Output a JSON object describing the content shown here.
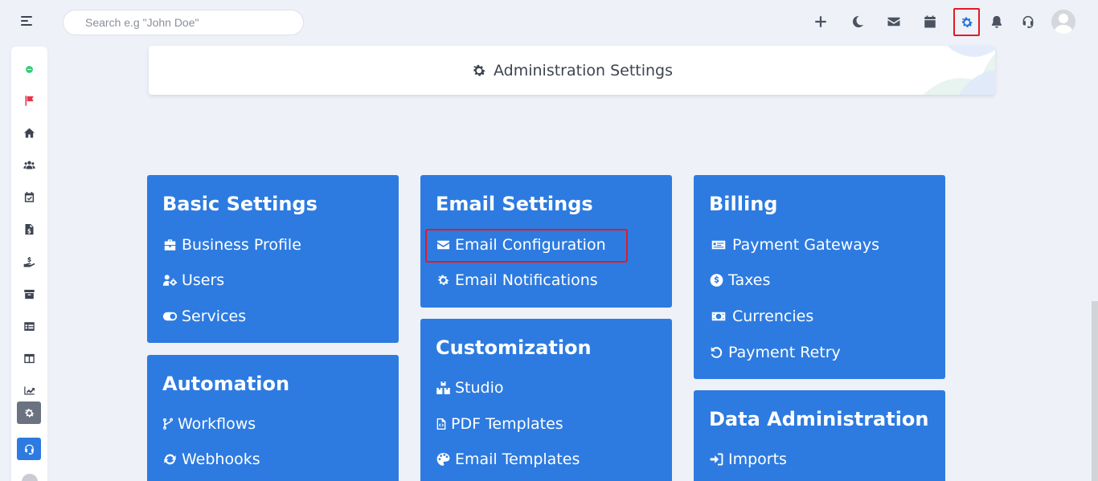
{
  "topbar": {
    "search_placeholder": "Search e.g \"John Doe\"",
    "icons": [
      "plus-icon",
      "moon-icon",
      "envelope-icon",
      "calendar-icon",
      "gear-icon",
      "bell-icon",
      "headset-icon"
    ],
    "active_icon": "gear-icon"
  },
  "sidebar": {
    "icons": [
      "status-dot-icon",
      "flag-icon",
      "home-icon",
      "users-icon",
      "calendar-check-icon",
      "invoice-icon",
      "payment-hand-icon",
      "archive-icon",
      "table-icon",
      "columns-icon",
      "chart-line-icon",
      "gear-icon",
      "headset-icon"
    ],
    "status_color": "#2ecc71",
    "flag_color": "#e8334a",
    "active_settings_bg": "#6b7280",
    "support_bg": "#2d7be0"
  },
  "header": {
    "title": "Administration Settings"
  },
  "sections": [
    {
      "title": "Basic Settings",
      "items": [
        {
          "label": "Business Profile",
          "icon": "briefcase-icon"
        },
        {
          "label": "Users",
          "icon": "users-cog-icon"
        },
        {
          "label": "Services",
          "icon": "toggle-icon"
        }
      ]
    },
    {
      "title": "Email Settings",
      "items": [
        {
          "label": "Email Configuration",
          "icon": "envelope-icon",
          "highlighted": true
        },
        {
          "label": "Email Notifications",
          "icon": "gear-icon"
        }
      ]
    },
    {
      "title": "Billing",
      "items": [
        {
          "label": "Payment Gateways",
          "icon": "money-check-icon"
        },
        {
          "label": "Taxes",
          "icon": "dollar-circle-icon"
        },
        {
          "label": "Currencies",
          "icon": "money-bill-icon"
        },
        {
          "label": "Payment Retry",
          "icon": "retry-icon"
        }
      ]
    },
    {
      "title": "Automation",
      "items": [
        {
          "label": "Workflows",
          "icon": "code-branch-icon"
        },
        {
          "label": "Webhooks",
          "icon": "sync-icon"
        }
      ]
    },
    {
      "title": "Customization",
      "items": [
        {
          "label": "Studio",
          "icon": "cubes-icon"
        },
        {
          "label": "PDF Templates",
          "icon": "file-code-icon"
        },
        {
          "label": "Email Templates",
          "icon": "palette-icon"
        }
      ]
    },
    {
      "title": "Data Administration",
      "items": [
        {
          "label": "Imports",
          "icon": "sign-in-icon"
        }
      ]
    }
  ],
  "colors": {
    "card_blue": "#2d7be0",
    "highlight_red": "#e01b24",
    "page_bg": "#eef1f8"
  }
}
